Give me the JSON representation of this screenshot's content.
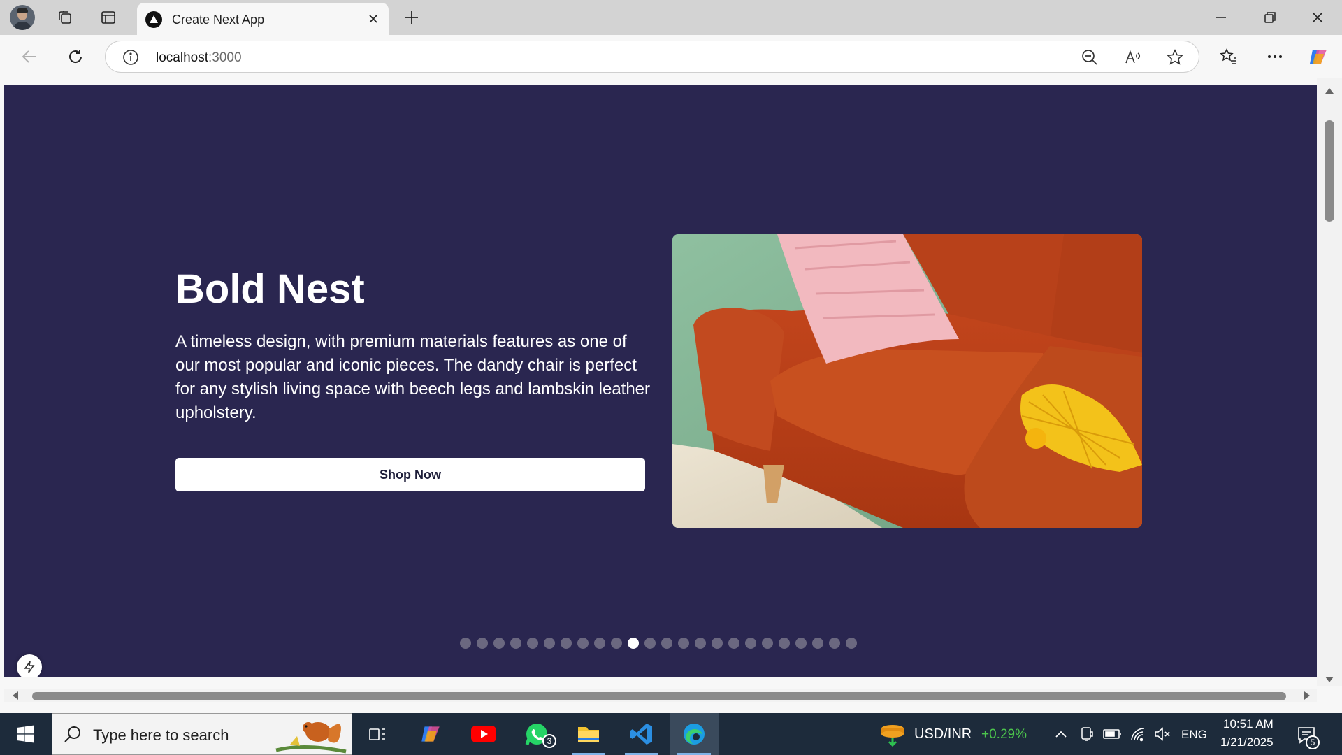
{
  "browser": {
    "tab_title": "Create Next App",
    "url_host": "localhost",
    "url_port": ":3000"
  },
  "hero": {
    "title": "Bold Nest",
    "description": "A timeless design, with premium materials features as one of our most popular and iconic pieces. The dandy chair is perfect for any stylish living space with beech legs and lambskin leather upholstery.",
    "cta_label": "Shop Now",
    "background": "#2a2650",
    "image": "orange-sofa-with-pink-pillow"
  },
  "carousel": {
    "total_slides": 24,
    "active_index": 10
  },
  "taskbar": {
    "search_placeholder": "Type here to search",
    "stock_label": "USD/INR",
    "stock_change": "+0.29%",
    "language": "ENG",
    "time": "10:51 AM",
    "date": "1/21/2025",
    "whatsapp_badge": "3",
    "notification_badge": "5"
  },
  "colors": {
    "page_bg": "#2a2650",
    "stock_positive": "#4cc44c"
  }
}
